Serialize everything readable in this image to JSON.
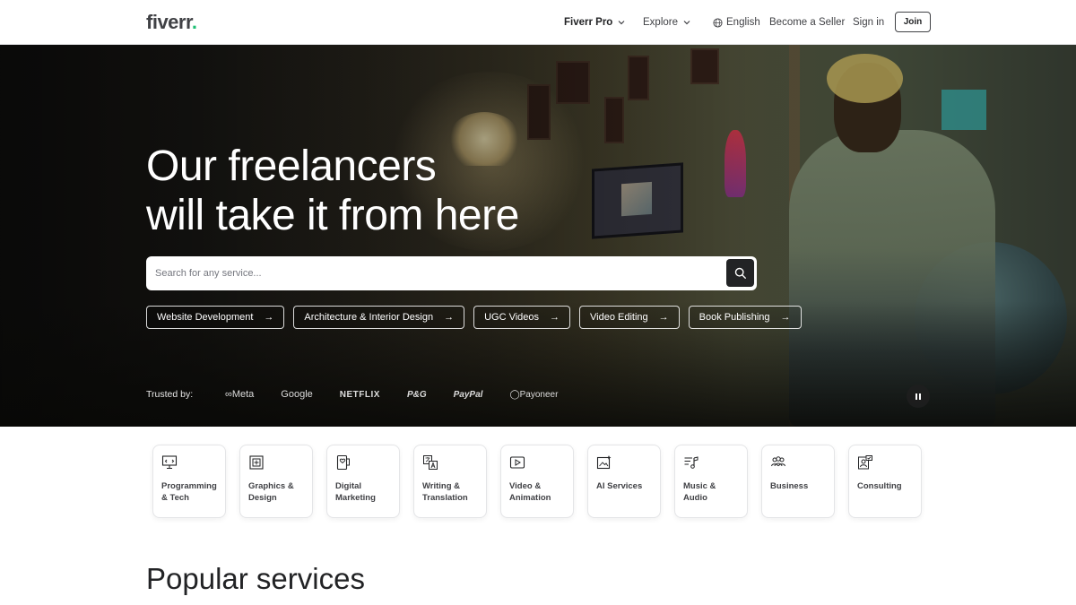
{
  "header": {
    "logo": "fiverr",
    "logo_dot": ".",
    "nav": {
      "pro": "Fiverr Pro",
      "explore": "Explore",
      "language": "English",
      "become_seller": "Become a Seller",
      "sign_in": "Sign in",
      "join": "Join"
    }
  },
  "hero": {
    "title_line1": "Our freelancers",
    "title_line2": "will take it from here",
    "search": {
      "placeholder": "Search for any service..."
    },
    "chips": [
      {
        "label": "Website Development",
        "arrow": "→"
      },
      {
        "label": "Architecture & Interior Design",
        "arrow": "→"
      },
      {
        "label": "UGC Videos",
        "arrow": "→"
      },
      {
        "label": "Video Editing",
        "arrow": "→"
      },
      {
        "label": "Book Publishing",
        "arrow": "→"
      }
    ],
    "trusted_by": {
      "label": "Trusted by:",
      "brands": [
        "∞Meta",
        "Google",
        "NETFLIX",
        "P&G",
        "PayPal",
        "◯Payoneer"
      ]
    }
  },
  "categories": [
    {
      "line1": "Programming",
      "line2": "& Tech",
      "icon": "monitor-code-icon"
    },
    {
      "line1": "Graphics &",
      "line2": "Design",
      "icon": "graphics-frame-icon"
    },
    {
      "line1": "Digital",
      "line2": "Marketing",
      "icon": "tablet-heart-icon"
    },
    {
      "line1": "Writing &",
      "line2": "Translation",
      "icon": "translate-icon"
    },
    {
      "line1": "Video &",
      "line2": "Animation",
      "icon": "video-play-icon"
    },
    {
      "line1": "AI Services",
      "line2": "",
      "icon": "ai-sparkle-icon"
    },
    {
      "line1": "Music & Audio",
      "line2": "",
      "icon": "music-icon"
    },
    {
      "line1": "Business",
      "line2": "",
      "icon": "people-icon"
    },
    {
      "line1": "Consulting",
      "line2": "",
      "icon": "consulting-icon"
    }
  ],
  "section_title": "Popular services",
  "colors": {
    "brand_green": "#1dbf73",
    "text_dark": "#222325"
  }
}
